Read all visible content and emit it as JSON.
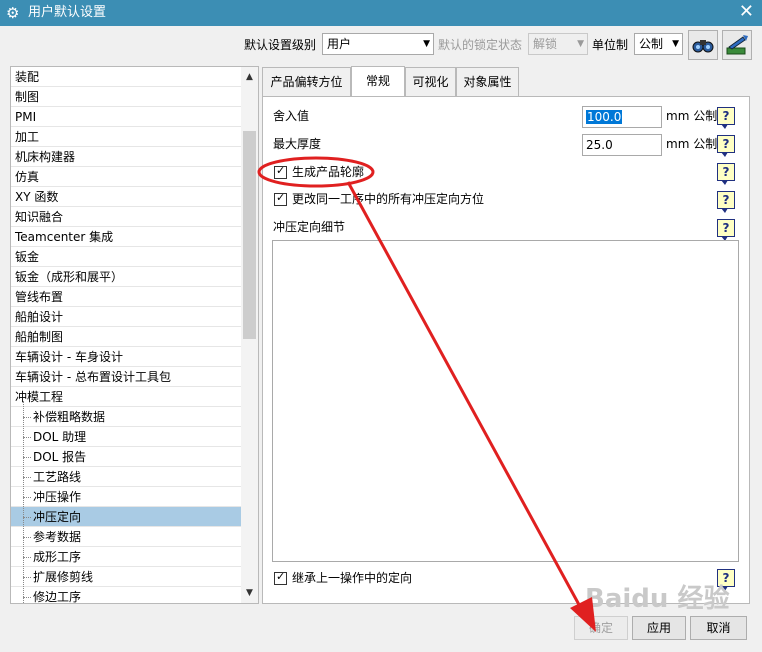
{
  "window": {
    "title": "用户默认设置",
    "icon": "gear-icon",
    "close_icon": "close-icon"
  },
  "toolbar": {
    "level_label": "默认设置级别",
    "level_value": "用户",
    "lock_label": "默认的锁定状态",
    "lock_value": "解锁",
    "unit_label": "单位制",
    "unit_value": "公制",
    "tool_icons": [
      "binoculars-icon",
      "import-export-icon"
    ]
  },
  "tree": {
    "items": [
      {
        "label": "装配"
      },
      {
        "label": "制图"
      },
      {
        "label": "PMI"
      },
      {
        "label": "加工"
      },
      {
        "label": "机床构建器"
      },
      {
        "label": "仿真"
      },
      {
        "label": "XY 函数"
      },
      {
        "label": "知识融合"
      },
      {
        "label": "Teamcenter 集成"
      },
      {
        "label": "钣金"
      },
      {
        "label": "钣金（成形和展平）"
      },
      {
        "label": "管线布置"
      },
      {
        "label": "船舶设计"
      },
      {
        "label": "船舶制图"
      },
      {
        "label": "车辆设计 - 车身设计"
      },
      {
        "label": "车辆设计 - 总布置设计工具包"
      },
      {
        "label": "冲模工程"
      },
      {
        "label": "补偿粗略数据",
        "child": true
      },
      {
        "label": "DOL 助理",
        "child": true
      },
      {
        "label": "DOL 报告",
        "child": true
      },
      {
        "label": "工艺路线",
        "child": true
      },
      {
        "label": "冲压操作",
        "child": true
      },
      {
        "label": "冲压定向",
        "child": true,
        "selected": true
      },
      {
        "label": "参考数据",
        "child": true
      },
      {
        "label": "成形工序",
        "child": true
      },
      {
        "label": "扩展修剪线",
        "child": true
      },
      {
        "label": "修边工序",
        "child": true
      }
    ]
  },
  "tabs": [
    {
      "label": "产品偏转方位"
    },
    {
      "label": "常规",
      "active": true
    },
    {
      "label": "可视化"
    },
    {
      "label": "对象属性"
    }
  ],
  "general": {
    "rounding_label": "舍入值",
    "rounding_value": "100.0",
    "rounding_unit": "mm 公制",
    "max_thickness_label": "最大厚度",
    "max_thickness_value": "25.0",
    "max_thickness_unit": "mm 公制",
    "generate_outline_label": "生成产品轮廓",
    "generate_outline_checked": true,
    "change_all_label": "更改同一工序中的所有冲压定向方位",
    "change_all_checked": true,
    "details_label": "冲压定向细节",
    "inherit_label": "继承上一操作中的定向",
    "inherit_checked": true,
    "help_glyph": "?"
  },
  "buttons": {
    "ok": "确定",
    "apply": "应用",
    "cancel": "取消"
  },
  "annotation": {
    "color": "#e02020"
  },
  "watermark": {
    "text": "Baidu 经验"
  }
}
